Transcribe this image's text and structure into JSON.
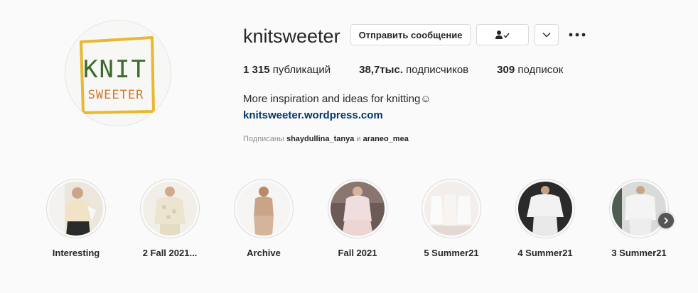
{
  "profile": {
    "username": "knitsweeter",
    "logo_text_top": "KNIT",
    "logo_text_bottom": "SWEETER",
    "message_button": "Отправить сообщение",
    "following_icon": "person-check-icon",
    "suggest_icon": "chevron-down-icon",
    "more_icon": "more-horizontal-icon"
  },
  "stats": {
    "posts_count": "1 315",
    "posts_label": " публикаций",
    "followers_count": "38,7тыс.",
    "followers_label": " подписчиков",
    "following_count": "309",
    "following_label": " подписок"
  },
  "bio": {
    "text": "More inspiration and ideas for knitting☺",
    "link": "knitsweeter.wordpress.com",
    "followed_prefix": "Подписаны ",
    "followed_user1": "shaydullina_tanya",
    "followed_and": " и ",
    "followed_user2": "araneo_mea"
  },
  "highlights": [
    {
      "label": "Interesting"
    },
    {
      "label": "2 Fall 2021..."
    },
    {
      "label": "Archive"
    },
    {
      "label": "Fall 2021"
    },
    {
      "label": "5 Summer21"
    },
    {
      "label": "4 Summer21"
    },
    {
      "label": "3 Summer21"
    }
  ],
  "colors": {
    "logo_frame": "#e8b830",
    "logo_knit": "#3d6b2a",
    "logo_sweeter": "#d07a2a",
    "link": "#00376b",
    "muted": "#8e8e8e"
  }
}
